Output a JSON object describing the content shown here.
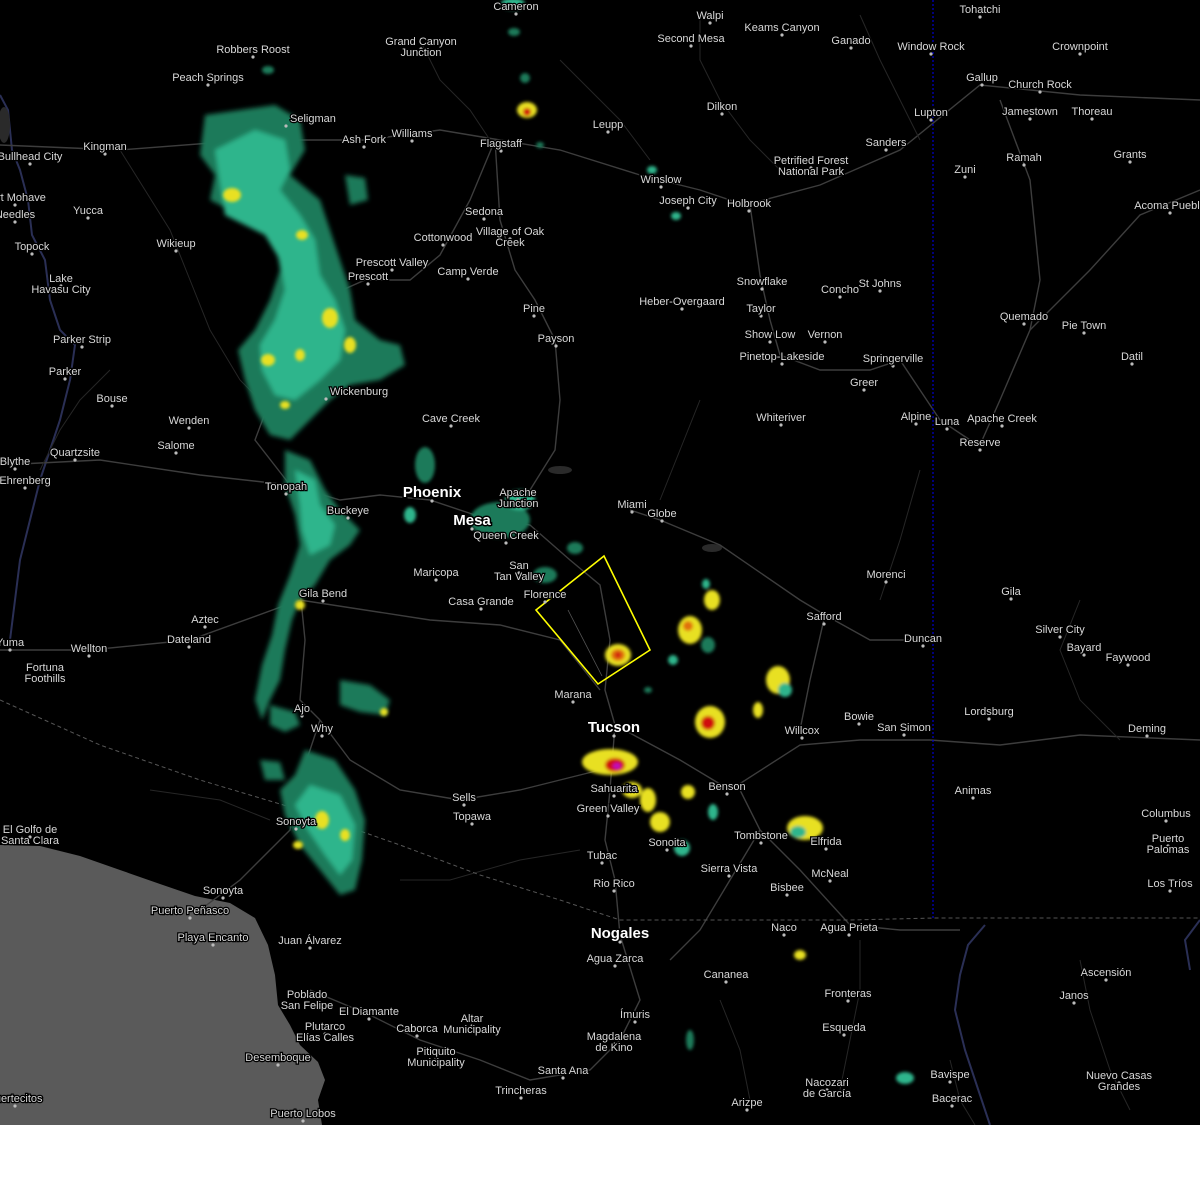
{
  "map": {
    "warning_polygon_color": "#ffff00",
    "state_line_color": "#0000cc",
    "land_color": "#000000",
    "sea_color": "#5a5a5a",
    "radar_colors": {
      "light": "#1d7a5a",
      "moderate": "#2fb58c",
      "heavy": "#e8e020",
      "intense": "#e07010",
      "extreme": "#d01010",
      "hail": "#c010c0"
    }
  },
  "places": [
    {
      "name": "Cameron"
    },
    {
      "name": "Tohatchi"
    },
    {
      "name": "Walpi"
    },
    {
      "name": "Keams Canyon"
    },
    {
      "name": "Robbers Roost"
    },
    {
      "name": "Grand Canyon Junction"
    },
    {
      "name": "Second Mesa"
    },
    {
      "name": "Ganado"
    },
    {
      "name": "Window Rock"
    },
    {
      "name": "Crownpoint"
    },
    {
      "name": "Peach Springs"
    },
    {
      "name": "Gallup"
    },
    {
      "name": "Church Rock"
    },
    {
      "name": "Seligman"
    },
    {
      "name": "Dilkon"
    },
    {
      "name": "Jamestown"
    },
    {
      "name": "Thoreau"
    },
    {
      "name": "Lupton"
    },
    {
      "name": "Bullhead City"
    },
    {
      "name": "Kingman"
    },
    {
      "name": "Ash Fork"
    },
    {
      "name": "Williams"
    },
    {
      "name": "Flagstaff"
    },
    {
      "name": "Leupp"
    },
    {
      "name": "Sanders"
    },
    {
      "name": "Fort Mohave"
    },
    {
      "name": "Petrified Forest National Park"
    },
    {
      "name": "Ramah"
    },
    {
      "name": "Grants"
    },
    {
      "name": "Needles"
    },
    {
      "name": "Winslow"
    },
    {
      "name": "Zuni"
    },
    {
      "name": "Yucca"
    },
    {
      "name": "Sedona"
    },
    {
      "name": "Joseph City"
    },
    {
      "name": "Holbrook"
    },
    {
      "name": "Acoma Pueblo"
    },
    {
      "name": "Topock"
    },
    {
      "name": "Wikieup"
    },
    {
      "name": "Cottonwood"
    },
    {
      "name": "Village of Oak Creek"
    },
    {
      "name": "Prescott Valley"
    },
    {
      "name": "Lake Havasu City"
    },
    {
      "name": "Prescott"
    },
    {
      "name": "Camp Verde"
    },
    {
      "name": "Snowflake"
    },
    {
      "name": "Concho"
    },
    {
      "name": "St Johns"
    },
    {
      "name": "Heber-Overgaard"
    },
    {
      "name": "Taylor"
    },
    {
      "name": "Pine"
    },
    {
      "name": "Quemado"
    },
    {
      "name": "Pie Town"
    },
    {
      "name": "Parker Strip"
    },
    {
      "name": "Payson"
    },
    {
      "name": "Show Low"
    },
    {
      "name": "Vernon"
    },
    {
      "name": "Pinetop-Lakeside"
    },
    {
      "name": "Springerville"
    },
    {
      "name": "Datil"
    },
    {
      "name": "Parker"
    },
    {
      "name": "Greer"
    },
    {
      "name": "Bouse"
    },
    {
      "name": "Wickenburg"
    },
    {
      "name": "Wenden"
    },
    {
      "name": "Cave Creek"
    },
    {
      "name": "Whiteriver"
    },
    {
      "name": "Alpine"
    },
    {
      "name": "Luna"
    },
    {
      "name": "Apache Creek"
    },
    {
      "name": "Salome"
    },
    {
      "name": "Reserve"
    },
    {
      "name": "Quartzsite"
    },
    {
      "name": "Blythe"
    },
    {
      "name": "Ehrenberg"
    },
    {
      "name": "Tonopah"
    },
    {
      "name": "Phoenix"
    },
    {
      "name": "Apache Junction"
    },
    {
      "name": "Miami"
    },
    {
      "name": "Globe"
    },
    {
      "name": "Buckeye"
    },
    {
      "name": "Mesa"
    },
    {
      "name": "Queen Creek"
    },
    {
      "name": "San Tan Valley"
    },
    {
      "name": "Maricopa"
    },
    {
      "name": "Morenci"
    },
    {
      "name": "Gila Bend"
    },
    {
      "name": "Florence"
    },
    {
      "name": "Casa Grande"
    },
    {
      "name": "Gila"
    },
    {
      "name": "Aztec"
    },
    {
      "name": "Safford"
    },
    {
      "name": "Silver City"
    },
    {
      "name": "Dateland"
    },
    {
      "name": "Duncan"
    },
    {
      "name": "Bayard"
    },
    {
      "name": "Yuma"
    },
    {
      "name": "Wellton"
    },
    {
      "name": "Faywood"
    },
    {
      "name": "Fortuna Foothills"
    },
    {
      "name": "Marana"
    },
    {
      "name": "Ajo"
    },
    {
      "name": "Lordsburg"
    },
    {
      "name": "Tucson"
    },
    {
      "name": "Bowie"
    },
    {
      "name": "San Simon"
    },
    {
      "name": "Willcox"
    },
    {
      "name": "Deming"
    },
    {
      "name": "Why"
    },
    {
      "name": "Sells"
    },
    {
      "name": "Sahuarita"
    },
    {
      "name": "Benson"
    },
    {
      "name": "Animas"
    },
    {
      "name": "Topawa"
    },
    {
      "name": "Green Valley"
    },
    {
      "name": "Columbus"
    },
    {
      "name": "El Golfo de Santa Clara"
    },
    {
      "name": "Sonoyta"
    },
    {
      "name": "Tombstone"
    },
    {
      "name": "Elfrida"
    },
    {
      "name": "Puerto Palomas"
    },
    {
      "name": "Sonoita"
    },
    {
      "name": "Tubac"
    },
    {
      "name": "Sierra Vista"
    },
    {
      "name": "McNeal"
    },
    {
      "name": "Los Tríos"
    },
    {
      "name": "Rio Rico"
    },
    {
      "name": "Bisbee"
    },
    {
      "name": "Sonoyta"
    },
    {
      "name": "Puerto Peñasco"
    },
    {
      "name": "Naco"
    },
    {
      "name": "Agua Prieta"
    },
    {
      "name": "Playa Encanto"
    },
    {
      "name": "Juan Álvarez"
    },
    {
      "name": "Nogales"
    },
    {
      "name": "Agua Zarca"
    },
    {
      "name": "Ascensión"
    },
    {
      "name": "Cananea"
    },
    {
      "name": "Janos"
    },
    {
      "name": "Fronteras"
    },
    {
      "name": "Poblado San Felipe"
    },
    {
      "name": "El Diamante"
    },
    {
      "name": "Plutarco Elías Calles"
    },
    {
      "name": "Altar Municipality"
    },
    {
      "name": "Caborca"
    },
    {
      "name": "Ímuris"
    },
    {
      "name": "Esqueda"
    },
    {
      "name": "Pitiquito Municipality"
    },
    {
      "name": "Magdalena de Kino"
    },
    {
      "name": "Desemboque"
    },
    {
      "name": "Santa Ana"
    },
    {
      "name": "Nacozari de García"
    },
    {
      "name": "Bavispe"
    },
    {
      "name": "Nuevo Casas Grandes"
    },
    {
      "name": "Trincheras"
    },
    {
      "name": "Bacerac"
    },
    {
      "name": "Arizpe"
    },
    {
      "name": "Puertecitos"
    },
    {
      "name": "Puerto Lobos"
    }
  ]
}
